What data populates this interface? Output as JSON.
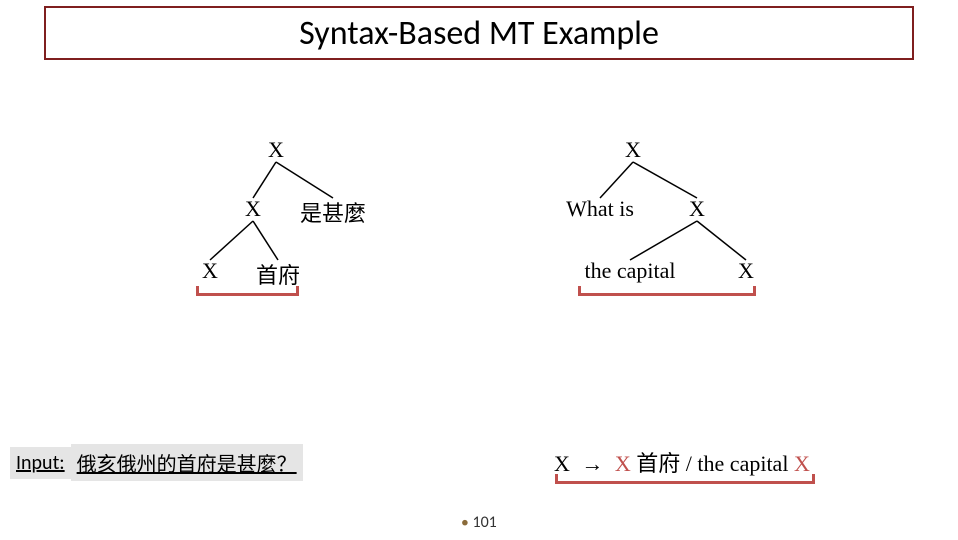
{
  "title": "Syntax-Based MT Example",
  "left_tree": {
    "root": "X",
    "level1": {
      "a": "X",
      "b": "是甚麼"
    },
    "level2": {
      "a": "X",
      "b": "首府"
    }
  },
  "right_tree": {
    "root": "X",
    "level1": {
      "a": "What is",
      "b": "X"
    },
    "level2": {
      "a": "the capital",
      "b": "X"
    }
  },
  "input": {
    "label": "Input:",
    "text": "俄亥俄州的首府是甚麼？"
  },
  "rule": {
    "lhs": "X",
    "arrow": "→",
    "rhs_x1": "X",
    "rhs_zh": "首府",
    "rhs_slash": "/",
    "rhs_en": "the capital",
    "rhs_x2": "X"
  },
  "page_number": "101"
}
